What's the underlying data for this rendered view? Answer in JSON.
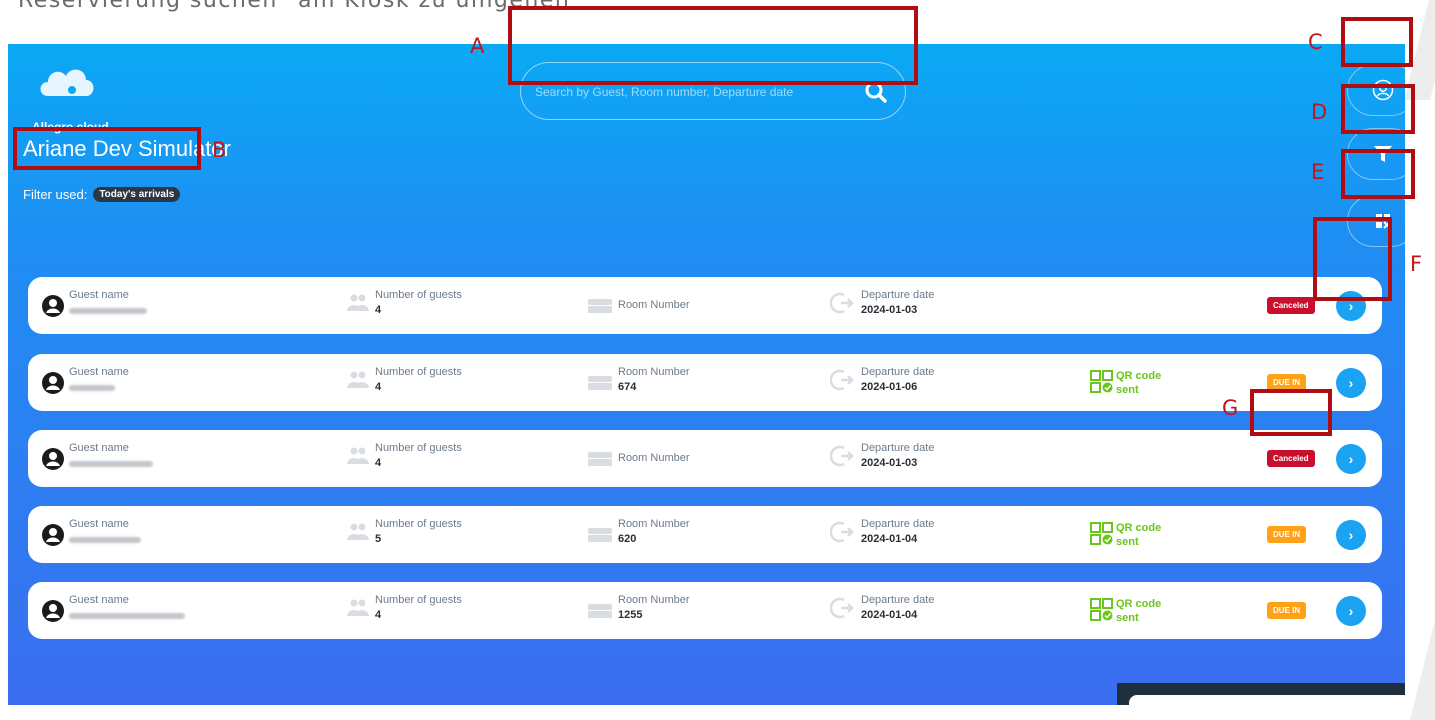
{
  "caption": "Reservierung suchen \"am Kiosk zu umgehen\"",
  "logo": {
    "text": "Allegro cloud"
  },
  "property_name": "Ariane Dev Simulator",
  "filter": {
    "label": "Filter used:",
    "chip": "Today's arrivals"
  },
  "search": {
    "placeholder": "Search by Guest, Room number, Departure date",
    "icon": "search-icon"
  },
  "side_buttons": [
    {
      "name": "profile-button",
      "icon": "user-circle-icon"
    },
    {
      "name": "filter-button",
      "icon": "funnel-icon"
    },
    {
      "name": "qr-scan-button",
      "icon": "qr-code-icon"
    }
  ],
  "labels": {
    "guest": "Guest name",
    "guests_count": "Number of guests",
    "room": "Room Number",
    "departure": "Departure date",
    "qr_code": "QR code",
    "qr_sent": "sent"
  },
  "reservations": [
    {
      "guests": "4",
      "room": "",
      "departure": "2024-01-03",
      "qr_sent": false,
      "status": "Canceled"
    },
    {
      "guests": "4",
      "room": "674",
      "departure": "2024-01-06",
      "qr_sent": true,
      "status": "DUE IN"
    },
    {
      "guests": "4",
      "room": "",
      "departure": "2024-01-03",
      "qr_sent": false,
      "status": "Canceled"
    },
    {
      "guests": "5",
      "room": "620",
      "departure": "2024-01-04",
      "qr_sent": true,
      "status": "DUE IN"
    },
    {
      "guests": "4",
      "room": "1255",
      "departure": "2024-01-04",
      "qr_sent": true,
      "status": "DUE IN"
    }
  ],
  "annotations": [
    "A",
    "B",
    "C",
    "D",
    "E",
    "F",
    "G"
  ],
  "colors": {
    "annotation": "#b00d12",
    "canceled": "#c8102e",
    "due_in": "#ffa21a",
    "qr_sent": "#6cc51f",
    "go_button": "#1aa3f2"
  }
}
